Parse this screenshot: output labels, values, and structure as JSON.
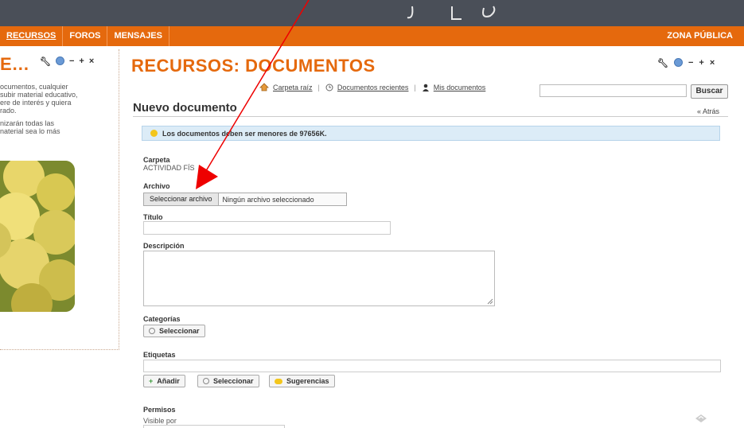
{
  "nav": {
    "items": [
      "RECURSOS",
      "FOROS",
      "MENSAJES"
    ],
    "zona": "ZONA PÚBLICA"
  },
  "left_portlet": {
    "title": "E...",
    "text1": "ocumentos, cualquier\n subir material educativo,\nere de interés y quiera\nrado.",
    "text2": "nizarán todas las\nnaterial sea lo más"
  },
  "main": {
    "title": "RECURSOS: DOCUMENTOS",
    "links": {
      "root": "Carpeta raíz",
      "recent": "Documentos recientes",
      "mine": "Mis documentos"
    },
    "search_button": "Buscar",
    "subtitle": "Nuevo documento",
    "back": "« Atrás",
    "info": "Los documentos deben ser menores de 97656K.",
    "folder_label": "Carpeta",
    "folder_value": "ACTIVIDAD FÍS",
    "file_label": "Archivo",
    "file_button": "Seleccionar archivo",
    "file_status": "Ningún archivo seleccionado",
    "title_label": "Título",
    "desc_label": "Descripción",
    "categories_label": "Categorías",
    "categories_button": "Seleccionar",
    "tags_label": "Etiquetas",
    "tags_add": "Añadir",
    "tags_select": "Seleccionar",
    "tags_suggest": "Sugerencias",
    "perms_label": "Permisos",
    "perms_visible": "Visible por"
  },
  "colors": {
    "accent": "#e5690d",
    "banner": "#4a4f58",
    "annotation_arrow": "#ff0000"
  }
}
